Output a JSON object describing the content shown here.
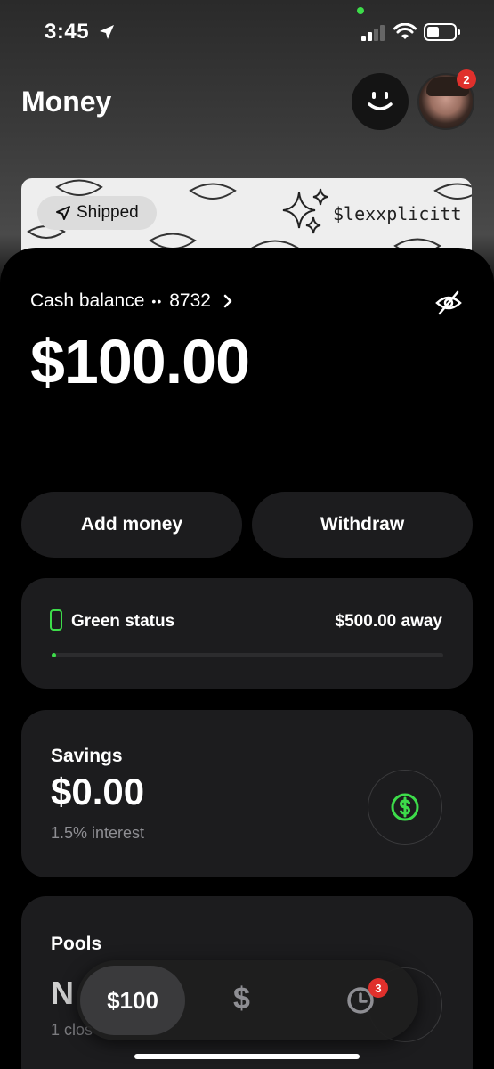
{
  "status_bar": {
    "time": "3:45"
  },
  "header": {
    "title": "Money",
    "avatar_badge": "2"
  },
  "card": {
    "chip_label": "Shipped",
    "cashtag": "$lexxplicitt"
  },
  "balance": {
    "label": "Cash balance",
    "masked_dots": "••",
    "last4": "8732",
    "amount": "$100.00"
  },
  "actions": {
    "add_money": "Add money",
    "withdraw": "Withdraw"
  },
  "green_status": {
    "label": "Green status",
    "away": "$500.00 away",
    "progress": 0
  },
  "savings": {
    "title": "Savings",
    "amount": "$0.00",
    "interest": "1.5% interest"
  },
  "pools": {
    "title": "Pools",
    "amount": "N",
    "subtitle": "1 clos"
  },
  "tabbar": {
    "money_tab": "$100",
    "dollar_tab": "$",
    "activity_badge": "3"
  },
  "colors": {
    "accent_green": "#3ddc4a",
    "badge_red": "#e0302c",
    "card_bg": "#1c1c1e"
  }
}
